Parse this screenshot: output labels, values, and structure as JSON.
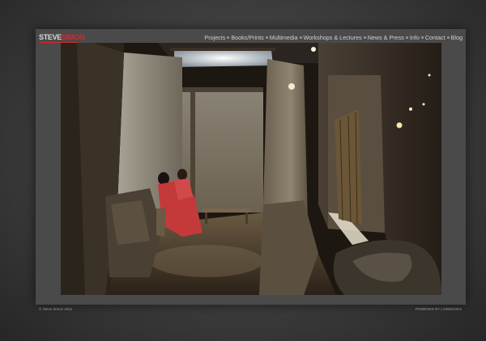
{
  "logo": {
    "part1": "STEVE",
    "part2": "SIMON"
  },
  "nav": {
    "items": [
      {
        "label": "Projects"
      },
      {
        "label": "Books/Prints"
      },
      {
        "label": "Multimedia"
      },
      {
        "label": "Workshops & Lectures"
      },
      {
        "label": "News & Press"
      },
      {
        "label": "Info"
      },
      {
        "label": "Contact"
      },
      {
        "label": "Blog"
      }
    ]
  },
  "footer": {
    "copyright": "© Steve Simon 2012",
    "powered": "POWERED BY LIVEBOOKS"
  },
  "colors": {
    "accent": "#d8262c",
    "frame": "#4a4a4a"
  }
}
